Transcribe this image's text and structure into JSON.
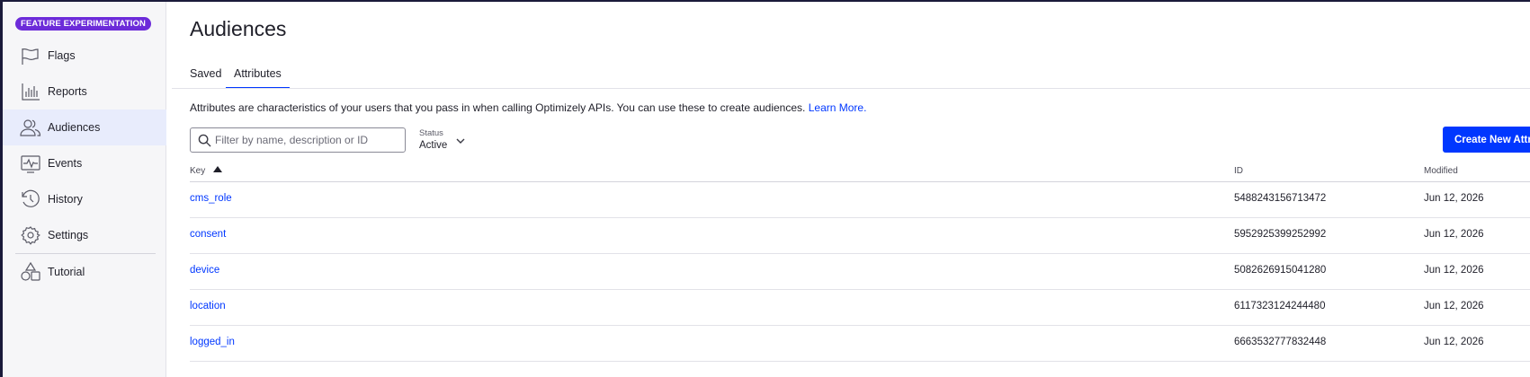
{
  "sidebar": {
    "product_badge": "FEATURE EXPERIMENTATION",
    "items": [
      {
        "label": "Flags",
        "icon": "flag-icon"
      },
      {
        "label": "Reports",
        "icon": "bar-chart-icon"
      },
      {
        "label": "Audiences",
        "icon": "users-icon",
        "active": true
      },
      {
        "label": "Events",
        "icon": "pulse-icon"
      },
      {
        "label": "History",
        "icon": "history-icon"
      },
      {
        "label": "Settings",
        "icon": "gear-icon"
      },
      {
        "label": "Tutorial",
        "icon": "shapes-icon"
      }
    ]
  },
  "page": {
    "title": "Audiences",
    "tabs": [
      {
        "label": "Saved",
        "active": false
      },
      {
        "label": "Attributes",
        "active": true
      }
    ],
    "description": "Attributes are characteristics of your users that you pass in when calling Optimizely APIs. You can use these to create audiences.",
    "learn_more": "Learn More."
  },
  "filter": {
    "placeholder": "Filter by name, description or ID",
    "value": ""
  },
  "status": {
    "label": "Status",
    "value": "Active"
  },
  "create_button": "Create New Attribute",
  "table": {
    "columns": [
      "Key",
      "ID",
      "Modified"
    ],
    "sort": {
      "column": "Key",
      "direction": "ascending"
    },
    "rows": [
      {
        "key": "cms_role",
        "id": "5488243156713472",
        "modified": "Jun 12, 2026"
      },
      {
        "key": "consent",
        "id": "5952925399252992",
        "modified": "Jun 12, 2026"
      },
      {
        "key": "device",
        "id": "5082626915041280",
        "modified": "Jun 12, 2026"
      },
      {
        "key": "location",
        "id": "6117323124244480",
        "modified": "Jun 12, 2026"
      },
      {
        "key": "logged_in",
        "id": "6663532777832448",
        "modified": "Jun 12, 2026"
      }
    ]
  },
  "colors": {
    "accent": "#0037ff",
    "badge": "#6c2bd9",
    "active_nav_bg": "#e8ecfc"
  }
}
